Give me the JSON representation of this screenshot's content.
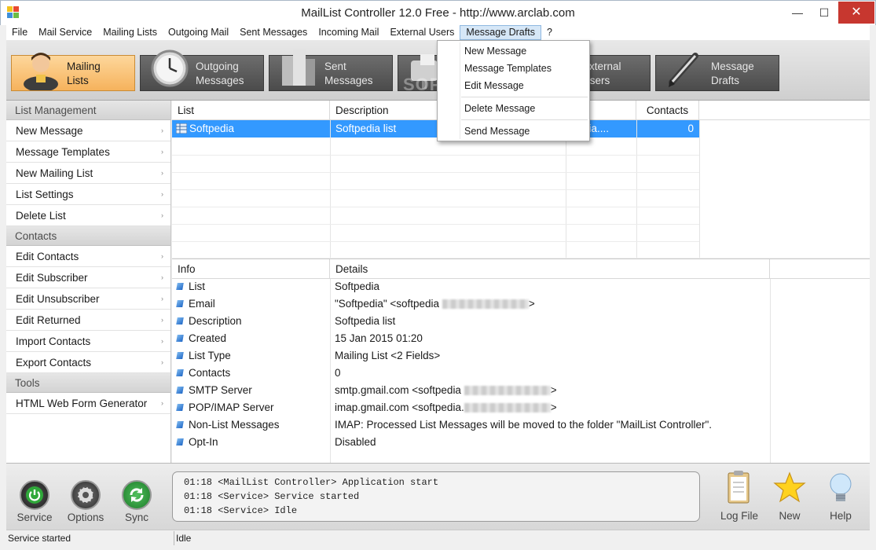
{
  "window": {
    "title": "MailList Controller 12.0 Free - http://www.arclab.com",
    "minimize_glyph": "—",
    "maximize_glyph": "☐",
    "close_glyph": "✕"
  },
  "menubar": {
    "items": [
      "File",
      "Mail Service",
      "Mailing Lists",
      "Outgoing Mail",
      "Sent Messages",
      "Incoming Mail",
      "External Users",
      "Message Drafts",
      "?"
    ],
    "active": "Message Drafts"
  },
  "toolbar": {
    "buttons": [
      {
        "line1": "Mailing",
        "line2": "Lists",
        "icon": "user-avatar-icon",
        "active": true
      },
      {
        "line1": "Outgoing",
        "line2": "Messages",
        "icon": "clock-icon"
      },
      {
        "line1": "Sent",
        "line2": "Messages",
        "icon": "buildings-icon"
      },
      {
        "line1": "",
        "line2": "",
        "icon": "mailbox-icon"
      },
      {
        "line1": "External",
        "line2": "Users",
        "icon": "users-icon"
      },
      {
        "line1": "Message",
        "line2": "Drafts",
        "icon": "pen-icon"
      }
    ],
    "watermark": "SOFTPEDIA"
  },
  "sidebar": {
    "sections": [
      {
        "title": "List Management",
        "items": [
          "New Message",
          "Message Templates",
          "New Mailing List",
          "List Settings",
          "Delete List"
        ]
      },
      {
        "title": "Contacts",
        "items": [
          "Edit Contacts",
          "Edit Subscriber",
          "Edit Unsubscriber",
          "Edit Returned",
          "Import Contacts",
          "Export Contacts"
        ]
      },
      {
        "title": "Tools",
        "items": [
          "HTML Web Form Generator"
        ]
      }
    ],
    "arrow": "›"
  },
  "lists_table": {
    "columns": [
      "List",
      "Description",
      "Email",
      "Contacts"
    ],
    "email_col_visible": "ail",
    "rows": [
      {
        "list": "Softpedia",
        "description": "Softpedia list",
        "email": "pedia....",
        "contacts": "0"
      }
    ]
  },
  "info_table": {
    "columns": [
      "Info",
      "Details"
    ],
    "rows": [
      {
        "key": "List",
        "value": "Softpedia"
      },
      {
        "key": "Email",
        "value": "\"Softpedia\" <softpedia",
        "tail": ">",
        "blurred": true
      },
      {
        "key": "Description",
        "value": "Softpedia list"
      },
      {
        "key": "Created",
        "value": "15 Jan 2015 01:20"
      },
      {
        "key": "List Type",
        "value": "Mailing List <2 Fields>"
      },
      {
        "key": "Contacts",
        "value": "0"
      },
      {
        "key": "SMTP Server",
        "value": "smtp.gmail.com <softpedia",
        "tail": ">",
        "blurred": true
      },
      {
        "key": "POP/IMAP Server",
        "value": "imap.gmail.com <softpedia.",
        "tail": ">",
        "blurred": true
      },
      {
        "key": "Non-List Messages",
        "value": "IMAP: Processed List Messages will be moved to the folder \"MailList Controller\"."
      },
      {
        "key": "Opt-In",
        "value": "Disabled"
      }
    ]
  },
  "dropdown": {
    "items": [
      "New Message",
      "Message Templates",
      "Edit Message",
      "Delete Message",
      "Send Message"
    ]
  },
  "bottom": {
    "round_buttons": [
      {
        "label": "Service",
        "icon": "power-icon",
        "color": "#2fa83a"
      },
      {
        "label": "Options",
        "icon": "gear-icon",
        "color": "#5a5a5a"
      },
      {
        "label": "Sync",
        "icon": "sync-icon",
        "color": "#32b044"
      }
    ],
    "log": [
      "01:18 <MailList Controller> Application start",
      "01:18 <Service> Service started",
      "01:18 <Service> Idle"
    ],
    "action_buttons": [
      {
        "label": "Log File",
        "icon": "clipboard-icon"
      },
      {
        "label": "New",
        "icon": "star-icon"
      },
      {
        "label": "Help",
        "icon": "lightbulb-icon"
      }
    ]
  },
  "statusbar": {
    "left": "Service started",
    "right": "Idle"
  }
}
